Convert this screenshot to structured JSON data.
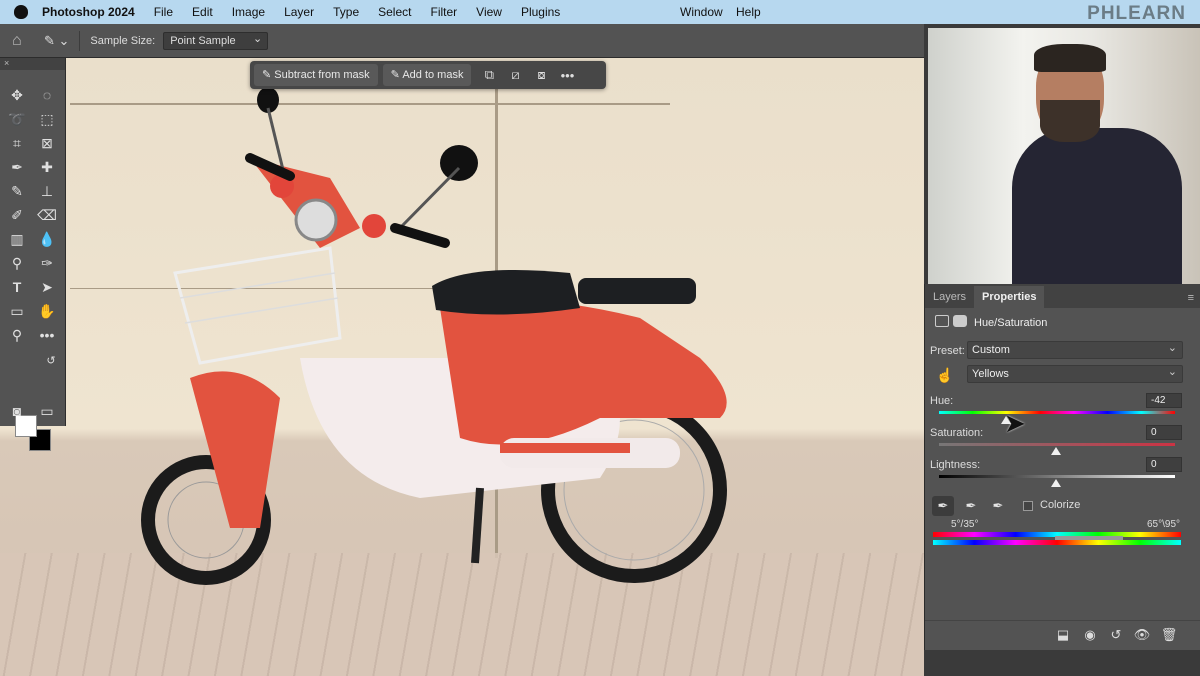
{
  "menubar": {
    "items": [
      "Photoshop 2024",
      "File",
      "Edit",
      "Image",
      "Layer",
      "Type",
      "Select",
      "Filter",
      "View",
      "Plugins"
    ],
    "right_items": [
      "Window",
      "Help"
    ],
    "brand_logo": "PHLEARN"
  },
  "options_bar": {
    "sample_size_label": "Sample Size:",
    "sample_size_value": "Point Sample"
  },
  "contextual_taskbar": {
    "subtract_label": "Subtract from mask",
    "add_label": "Add to mask"
  },
  "panel": {
    "tabs": [
      {
        "label": "Layers",
        "active": false
      },
      {
        "label": "Properties",
        "active": true
      }
    ],
    "adjustment_title": "Hue/Saturation",
    "preset_label": "Preset:",
    "preset_value": "Custom",
    "channel_value": "Yellows",
    "hue_label": "Hue:",
    "hue_value": "-42",
    "saturation_label": "Saturation:",
    "saturation_value": "0",
    "lightness_label": "Lightness:",
    "lightness_value": "0",
    "colorize_label": "Colorize",
    "range_left": "5°/35°",
    "range_right": "65°\\95°"
  },
  "colors": {
    "menubar_bg": "#b7d8ef",
    "panel_bg": "#535353",
    "scooter_red": "#e2533f"
  }
}
